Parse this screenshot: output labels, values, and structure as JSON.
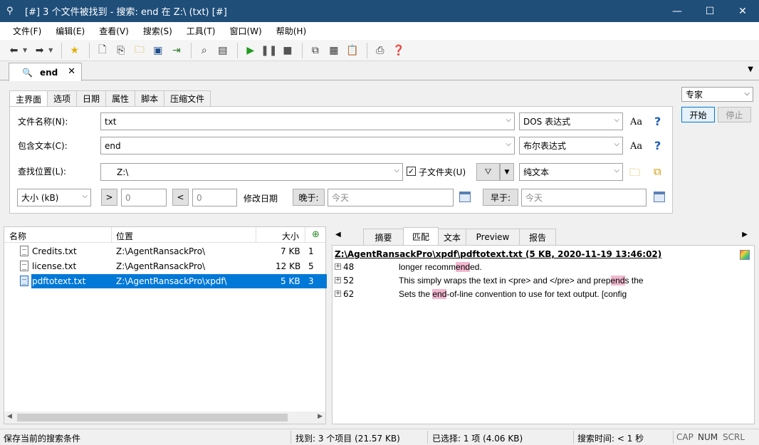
{
  "window": {
    "title": "[#] 3 个文件被找到 - 搜索: end 在 Z:\\ (txt) [#]",
    "minimize": "—",
    "maximize": "☐",
    "close": "✕"
  },
  "menu": [
    "文件(F)",
    "编辑(E)",
    "查看(V)",
    "搜索(S)",
    "工具(T)",
    "窗口(W)",
    "帮助(H)"
  ],
  "doc_tab": {
    "label": "end",
    "close": "✕",
    "dropdown": "▼"
  },
  "panel_tabs": [
    "主界面",
    "选项",
    "日期",
    "属性",
    "脚本",
    "压缩文件"
  ],
  "form": {
    "filename_label": "文件名称(N):",
    "filename_value": "txt",
    "filename_mode": "DOS 表达式",
    "content_label": "包含文本(C):",
    "content_value": "end",
    "content_mode": "布尔表达式",
    "location_label": "查找位置(L):",
    "location_value": "Z:\\",
    "subfolders_label": "子文件夹(U)",
    "location_mode": "纯文本",
    "aa": "Aa",
    "help": "?",
    "size_mode": "大小 (kB)",
    "gt": ">",
    "gt_value": "0",
    "lt": "<",
    "lt_value": "0",
    "modified_label": "修改日期",
    "later_label": "晚于:",
    "later_value": "今天",
    "earlier_label": "早于:",
    "earlier_value": "今天"
  },
  "right": {
    "mode": "专家",
    "start": "开始",
    "stop": "停止"
  },
  "results": {
    "headers": [
      "名称",
      "位置",
      "大小"
    ],
    "rows": [
      {
        "name": "Credits.txt",
        "location": "Z:\\AgentRansackPro\\",
        "size": "7 KB",
        "hits": "1"
      },
      {
        "name": "license.txt",
        "location": "Z:\\AgentRansackPro\\",
        "size": "12 KB",
        "hits": "5"
      },
      {
        "name": "pdftotext.txt",
        "location": "Z:\\AgentRansackPro\\xpdf\\",
        "size": "5 KB",
        "hits": "3"
      }
    ]
  },
  "preview": {
    "tabs": [
      "摘要",
      "匹配",
      "文本",
      "Preview",
      "报告"
    ],
    "header": "Z:\\AgentRansackPro\\xpdf\\pdftotext.txt  (5 KB,  2020-11-19 13:46:02)",
    "lines": [
      {
        "no": "48",
        "pre": "longer recomm",
        "hit": "end",
        "post": "ed."
      },
      {
        "no": "52",
        "pre": "This  simply wraps the text in <pre> and </pre> and prep",
        "hit": "end",
        "post": "s the"
      },
      {
        "no": "62",
        "pre": "Sets the ",
        "hit": "end",
        "post": "-of-line convention to use for text output.  [config"
      }
    ]
  },
  "status": {
    "left": "保存当前的搜索条件",
    "found": "找到: 3 个项目 (21.57 KB)",
    "selected": "已选择: 1 项 (4.06 KB)",
    "time": "搜索时间: < 1 秒",
    "caps": "CAP",
    "num": "NUM",
    "scrl": "SCRL"
  }
}
